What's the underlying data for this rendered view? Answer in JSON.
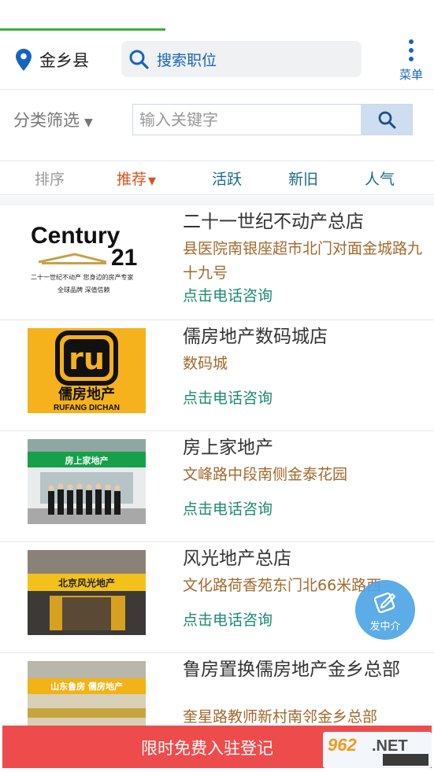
{
  "header": {
    "location": "金乡县",
    "search_placeholder": "搜索职位",
    "menu_label": "菜单"
  },
  "filter": {
    "category_label": "分类筛选",
    "keyword_placeholder": "输入关键字"
  },
  "sort": {
    "label": "排序",
    "options": [
      "推荐",
      "活跃",
      "新旧",
      "人气"
    ],
    "active": "推荐"
  },
  "listings": [
    {
      "name": "二十一世纪不动产总店",
      "address": "县医院南银座超市北门对面金城路九十九号",
      "action": "点击电话咨询",
      "logo_text": {
        "brand": "Century",
        "num": "21",
        "line1": "二十一世纪不动产  您身边的房产专家",
        "line2": "全球品牌  深值信赖"
      }
    },
    {
      "name": "儒房地产数码城店",
      "address": "数码城",
      "action": "点击电话咨询",
      "logo_text": {
        "mark": "ru",
        "cn": "儒房地产",
        "en": "RUFANG DICHAN"
      }
    },
    {
      "name": "房上家地产",
      "address": "文峰路中段南侧金泰花园",
      "action": "点击电话咨询",
      "logo_text": {
        "sign": "房上家地产"
      }
    },
    {
      "name": "风光地产总店",
      "address": "文化路荷香苑东门北66米路西",
      "action": "点击电话咨询",
      "logo_text": {
        "sign": "北京风光地产"
      }
    },
    {
      "name": "鲁房置换儒房地产金乡总部",
      "address": "奎星路教师新村南邻金乡总部",
      "action": "",
      "logo_text": {
        "sign": "山东鲁房  儒房地产"
      }
    }
  ],
  "float_button": {
    "label": "发中介"
  },
  "bottom_bar": {
    "label": "限时免费入驻登记"
  },
  "colors": {
    "accent": "#1565c0",
    "address": "#a3692c",
    "action": "#1b8a70",
    "banner": "#ee4c4c",
    "sort_active": "#d9531e"
  }
}
